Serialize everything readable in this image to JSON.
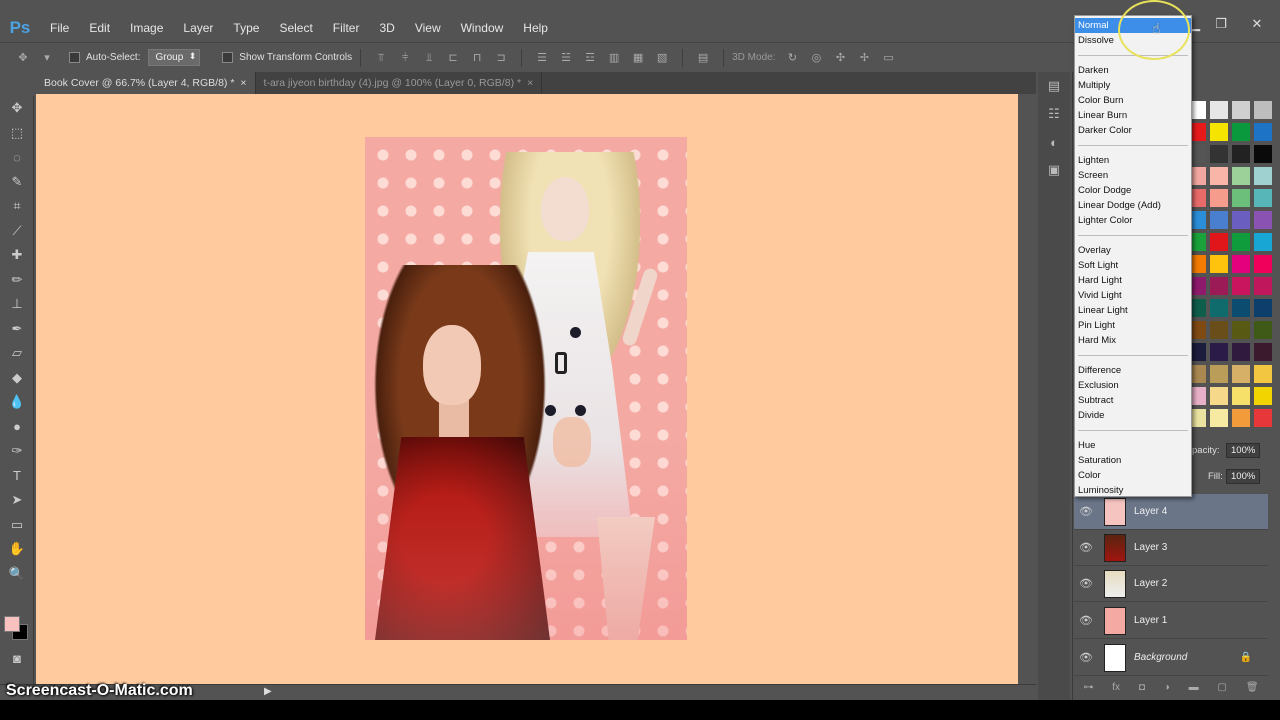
{
  "app": {
    "logo": "Ps"
  },
  "menu": [
    "File",
    "Edit",
    "Image",
    "Layer",
    "Type",
    "Select",
    "Filter",
    "3D",
    "View",
    "Window",
    "Help"
  ],
  "options": {
    "auto_select_label": "Auto-Select:",
    "group_value": "Group",
    "transform_label": "Show Transform Controls",
    "mode_label": "3D Mode:"
  },
  "tabs": [
    {
      "label": "Book Cover @ 66.7% (Layer 4, RGB/8) *",
      "close": "×"
    },
    {
      "label": "t-ara jiyeon birthday (4).jpg @ 100% (Layer 0, RGB/8) *",
      "close": "×"
    }
  ],
  "colors": {
    "canvas_bg": "#ffcb9e",
    "doc_bg": "#f4a9a3",
    "accent": "#3d8ee8",
    "foreground": "#f7c1c0",
    "background": "#000000"
  },
  "blend_modes": {
    "selected": "Normal",
    "groups": [
      [
        "Normal",
        "Dissolve"
      ],
      [
        "Darken",
        "Multiply",
        "Color Burn",
        "Linear Burn",
        "Darker Color"
      ],
      [
        "Lighten",
        "Screen",
        "Color Dodge",
        "Linear Dodge (Add)",
        "Lighter Color"
      ],
      [
        "Overlay",
        "Soft Light",
        "Hard Light",
        "Vivid Light",
        "Linear Light",
        "Pin Light",
        "Hard Mix"
      ],
      [
        "Difference",
        "Exclusion",
        "Subtract",
        "Divide"
      ],
      [
        "Hue",
        "Saturation",
        "Color",
        "Luminosity"
      ]
    ]
  },
  "layers_panel": {
    "opacity_label": "pacity:",
    "opacity_value": "100%",
    "fill_label": "Fill:",
    "fill_value": "100%",
    "layers": [
      {
        "name": "Layer 4",
        "active": true
      },
      {
        "name": "Layer 3",
        "active": false
      },
      {
        "name": "Layer 2",
        "active": false
      },
      {
        "name": "Layer 1",
        "active": false
      },
      {
        "name": "Background",
        "active": false,
        "locked": true
      }
    ]
  },
  "swatches": [
    "#ffffff",
    "#e6e6e6",
    "#d0d0d0",
    "#bdbdbd",
    "#e8191b",
    "#f5e300",
    "#0a9a3d",
    "#1d74c6",
    "#555555",
    "#333333",
    "#222222",
    "#0a0a0a",
    "#f2a8a0",
    "#f9b6a8",
    "#9cd19a",
    "#9fd1d0",
    "#e86b6a",
    "#f59c8c",
    "#6cbf7a",
    "#57b6b8",
    "#2b8ed8",
    "#4a7fd0",
    "#6a5fc0",
    "#8a53b3",
    "#1ba23a",
    "#e0161b",
    "#0f9c3c",
    "#18a7d4",
    "#f27b00",
    "#ffc20d",
    "#e4007c",
    "#f0005a",
    "#8e1a6c",
    "#9a1b55",
    "#c8155d",
    "#c0165c",
    "#0f5d4b",
    "#106b6c",
    "#0c4c6e",
    "#0e3e6c",
    "#7f4a14",
    "#6a4e1a",
    "#585a14",
    "#3e5a16",
    "#1c1c3c",
    "#2a1b48",
    "#301a3e",
    "#3c1a2e",
    "#a98852",
    "#bb9d5a",
    "#d6b066",
    "#f2c640",
    "#e8b0c8",
    "#f5d88a",
    "#f6e06a",
    "#f2d400",
    "#e9e2a0",
    "#f6e9a1",
    "#f29b3a",
    "#e8373a"
  ],
  "watermark": "Screencast-O-Matic.com"
}
